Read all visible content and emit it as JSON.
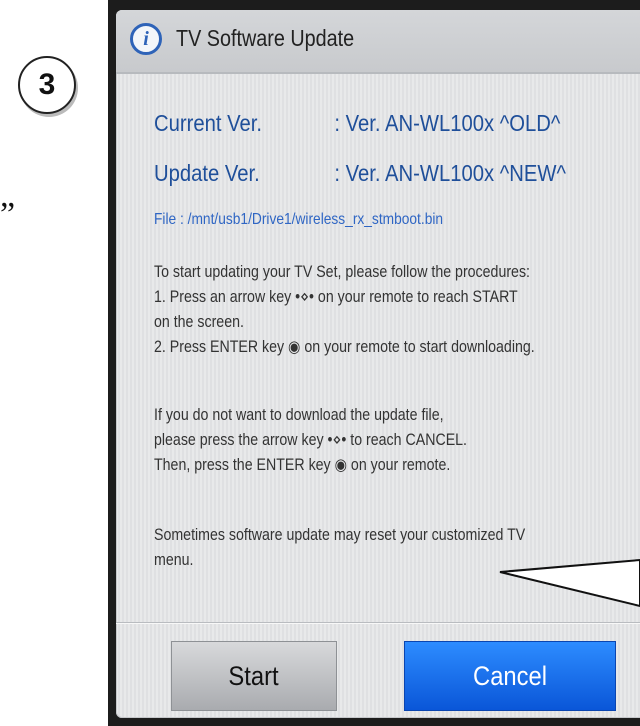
{
  "annotation": {
    "step_number": "3",
    "quote_mark": "”"
  },
  "dialog": {
    "icon": "info-icon",
    "icon_glyph": "i",
    "title": "TV Software Update",
    "current_label": "Current Ver.",
    "current_value": ": Ver. AN-WL100x ^OLD^",
    "update_label": "Update Ver.",
    "update_value": ": Ver. AN-WL100x ^NEW^",
    "file_line": "File : /mnt/usb1/Drive1/wireless_rx_stmboot.bin",
    "instructions": [
      "To start updating your TV Set, please follow the procedures:",
      "1. Press an arrow key •⋄• on your remote to reach START",
      "on the screen.",
      "2. Press ENTER key ◉ on your remote to start downloading."
    ],
    "cancel_info": [
      "If you do not want to download the update file,",
      "please press the arrow key •⋄• to reach CANCEL.",
      "Then, press the ENTER key ◉ on your remote."
    ],
    "warning": [
      "Sometimes software update may reset your customized TV",
      "menu."
    ],
    "start_label": "Start",
    "cancel_label": "Cancel"
  },
  "colors": {
    "accent_blue": "#1f4f9a",
    "button_blue": "#0a56d8"
  }
}
